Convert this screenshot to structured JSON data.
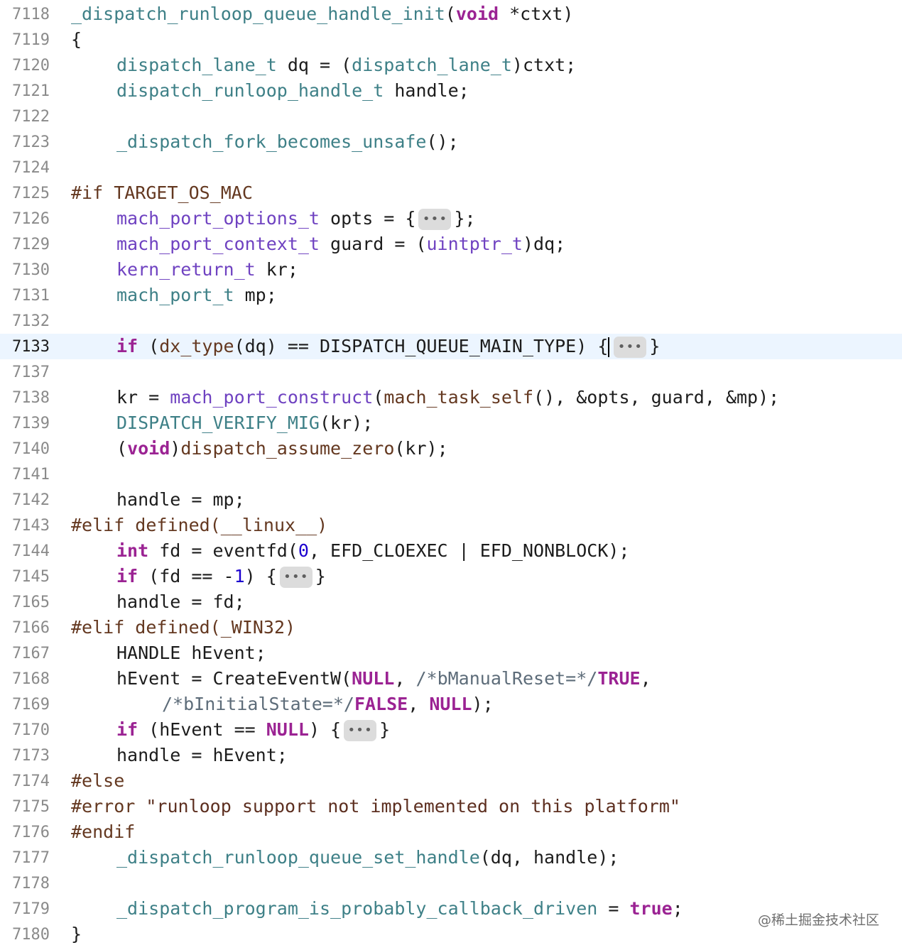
{
  "lines": [
    {
      "n": "7118",
      "tokens": [
        [
          "fn",
          "_dispatch_runloop_queue_handle_init"
        ],
        [
          "",
          "("
        ],
        [
          "kw",
          "void"
        ],
        [
          "",
          " *ctxt)"
        ]
      ]
    },
    {
      "n": "7119",
      "tokens": [
        [
          "",
          "{"
        ]
      ]
    },
    {
      "n": "7120",
      "tokens": [
        [
          "",
          " "
        ],
        [
          "ty",
          "dispatch_lane_t"
        ],
        [
          "",
          " dq = ("
        ],
        [
          "ty",
          "dispatch_lane_t"
        ],
        [
          "",
          ")ctxt;"
        ]
      ]
    },
    {
      "n": "7121",
      "tokens": [
        [
          "",
          " "
        ],
        [
          "ty",
          "dispatch_runloop_handle_t"
        ],
        [
          "",
          " handle;"
        ]
      ]
    },
    {
      "n": "7122",
      "tokens": []
    },
    {
      "n": "7123",
      "tokens": [
        [
          "",
          " "
        ],
        [
          "fn",
          "_dispatch_fork_becomes_unsafe"
        ],
        [
          "",
          "();"
        ]
      ]
    },
    {
      "n": "7124",
      "tokens": []
    },
    {
      "n": "7125",
      "tokens": [
        [
          "pp",
          "#if TARGET_OS_MAC"
        ]
      ]
    },
    {
      "n": "7126",
      "tokens": [
        [
          "",
          " "
        ],
        [
          "lfn",
          "mach_port_options_t"
        ],
        [
          "",
          " opts = {"
        ],
        [
          "fold",
          "•••"
        ],
        [
          "",
          "};"
        ]
      ]
    },
    {
      "n": "7129",
      "tokens": [
        [
          "",
          " "
        ],
        [
          "lfn",
          "mach_port_context_t"
        ],
        [
          "",
          " guard = ("
        ],
        [
          "lfn",
          "uintptr_t"
        ],
        [
          "",
          ")dq;"
        ]
      ]
    },
    {
      "n": "7130",
      "tokens": [
        [
          "",
          " "
        ],
        [
          "lfn",
          "kern_return_t"
        ],
        [
          "",
          " kr;"
        ]
      ]
    },
    {
      "n": "7131",
      "tokens": [
        [
          "",
          " "
        ],
        [
          "ty",
          "mach_port_t"
        ],
        [
          "",
          " mp;"
        ]
      ]
    },
    {
      "n": "7132",
      "tokens": []
    },
    {
      "n": "7133",
      "current": true,
      "tokens": [
        [
          "",
          " "
        ],
        [
          "kw",
          "if"
        ],
        [
          "",
          " ("
        ],
        [
          "mac",
          "dx_type"
        ],
        [
          "",
          "(dq) == DISPATCH_QUEUE_MAIN_TYPE) {"
        ],
        [
          "caret",
          ""
        ],
        [
          "fold",
          "•••"
        ],
        [
          "",
          "}"
        ]
      ]
    },
    {
      "n": "7137",
      "tokens": []
    },
    {
      "n": "7138",
      "tokens": [
        [
          "",
          " kr = "
        ],
        [
          "lfn",
          "mach_port_construct"
        ],
        [
          "",
          "("
        ],
        [
          "mac",
          "mach_task_self"
        ],
        [
          "",
          "(), &opts, guard, &mp);"
        ]
      ]
    },
    {
      "n": "7139",
      "tokens": [
        [
          "",
          " "
        ],
        [
          "fn",
          "DISPATCH_VERIFY_MIG"
        ],
        [
          "",
          "(kr);"
        ]
      ]
    },
    {
      "n": "7140",
      "tokens": [
        [
          "",
          " ("
        ],
        [
          "kw",
          "void"
        ],
        [
          "",
          ")"
        ],
        [
          "mac",
          "dispatch_assume_zero"
        ],
        [
          "",
          "(kr);"
        ]
      ]
    },
    {
      "n": "7141",
      "tokens": []
    },
    {
      "n": "7142",
      "tokens": [
        [
          "",
          " handle = mp;"
        ]
      ]
    },
    {
      "n": "7143",
      "tokens": [
        [
          "pp",
          "#elif defined(__linux__)"
        ]
      ]
    },
    {
      "n": "7144",
      "tokens": [
        [
          "",
          " "
        ],
        [
          "kw",
          "int"
        ],
        [
          "",
          " fd = eventfd("
        ],
        [
          "num",
          "0"
        ],
        [
          "",
          ", EFD_CLOEXEC | EFD_NONBLOCK);"
        ]
      ]
    },
    {
      "n": "7145",
      "tokens": [
        [
          "",
          " "
        ],
        [
          "kw",
          "if"
        ],
        [
          "",
          " (fd == -"
        ],
        [
          "num",
          "1"
        ],
        [
          "",
          ") {"
        ],
        [
          "fold",
          "•••"
        ],
        [
          "",
          "}"
        ]
      ]
    },
    {
      "n": "7165",
      "tokens": [
        [
          "",
          " handle = fd;"
        ]
      ]
    },
    {
      "n": "7166",
      "tokens": [
        [
          "pp",
          "#elif defined(_WIN32)"
        ]
      ]
    },
    {
      "n": "7167",
      "tokens": [
        [
          "",
          " HANDLE hEvent;"
        ]
      ]
    },
    {
      "n": "7168",
      "tokens": [
        [
          "",
          " hEvent = CreateEventW("
        ],
        [
          "kw",
          "NULL"
        ],
        [
          "",
          ", "
        ],
        [
          "com",
          "/*bManualReset=*/"
        ],
        [
          "kw",
          "TRUE"
        ],
        [
          "",
          ","
        ]
      ]
    },
    {
      "n": "7169",
      "tokens": [
        [
          "",
          " "
        ],
        [
          "com",
          "/*bInitialState=*/"
        ],
        [
          "kw",
          "FALSE"
        ],
        [
          "",
          ", "
        ],
        [
          "kw",
          "NULL"
        ],
        [
          "",
          ");"
        ]
      ]
    },
    {
      "n": "7170",
      "tokens": [
        [
          "",
          " "
        ],
        [
          "kw",
          "if"
        ],
        [
          "",
          " (hEvent == "
        ],
        [
          "kw",
          "NULL"
        ],
        [
          "",
          ") {"
        ],
        [
          "fold",
          "•••"
        ],
        [
          "",
          "}"
        ]
      ]
    },
    {
      "n": "7173",
      "tokens": [
        [
          "",
          " handle = hEvent;"
        ]
      ]
    },
    {
      "n": "7174",
      "tokens": [
        [
          "pp",
          "#else"
        ]
      ]
    },
    {
      "n": "7175",
      "tokens": [
        [
          "pp",
          "#error "
        ],
        [
          "str",
          "\"runloop support not implemented on this platform\""
        ]
      ]
    },
    {
      "n": "7176",
      "tokens": [
        [
          "pp",
          "#endif"
        ]
      ]
    },
    {
      "n": "7177",
      "tokens": [
        [
          "",
          " "
        ],
        [
          "fn",
          "_dispatch_runloop_queue_set_handle"
        ],
        [
          "",
          "(dq, handle);"
        ]
      ]
    },
    {
      "n": "7178",
      "tokens": []
    },
    {
      "n": "7179",
      "tokens": [
        [
          "",
          " "
        ],
        [
          "fn",
          "_dispatch_program_is_probably_callback_driven"
        ],
        [
          "",
          " = "
        ],
        [
          "kw",
          "true"
        ],
        [
          "",
          ";"
        ]
      ]
    },
    {
      "n": "7180",
      "tokens": [
        [
          "",
          "}"
        ]
      ]
    }
  ],
  "watermark": "@稀土掘金技术社区"
}
